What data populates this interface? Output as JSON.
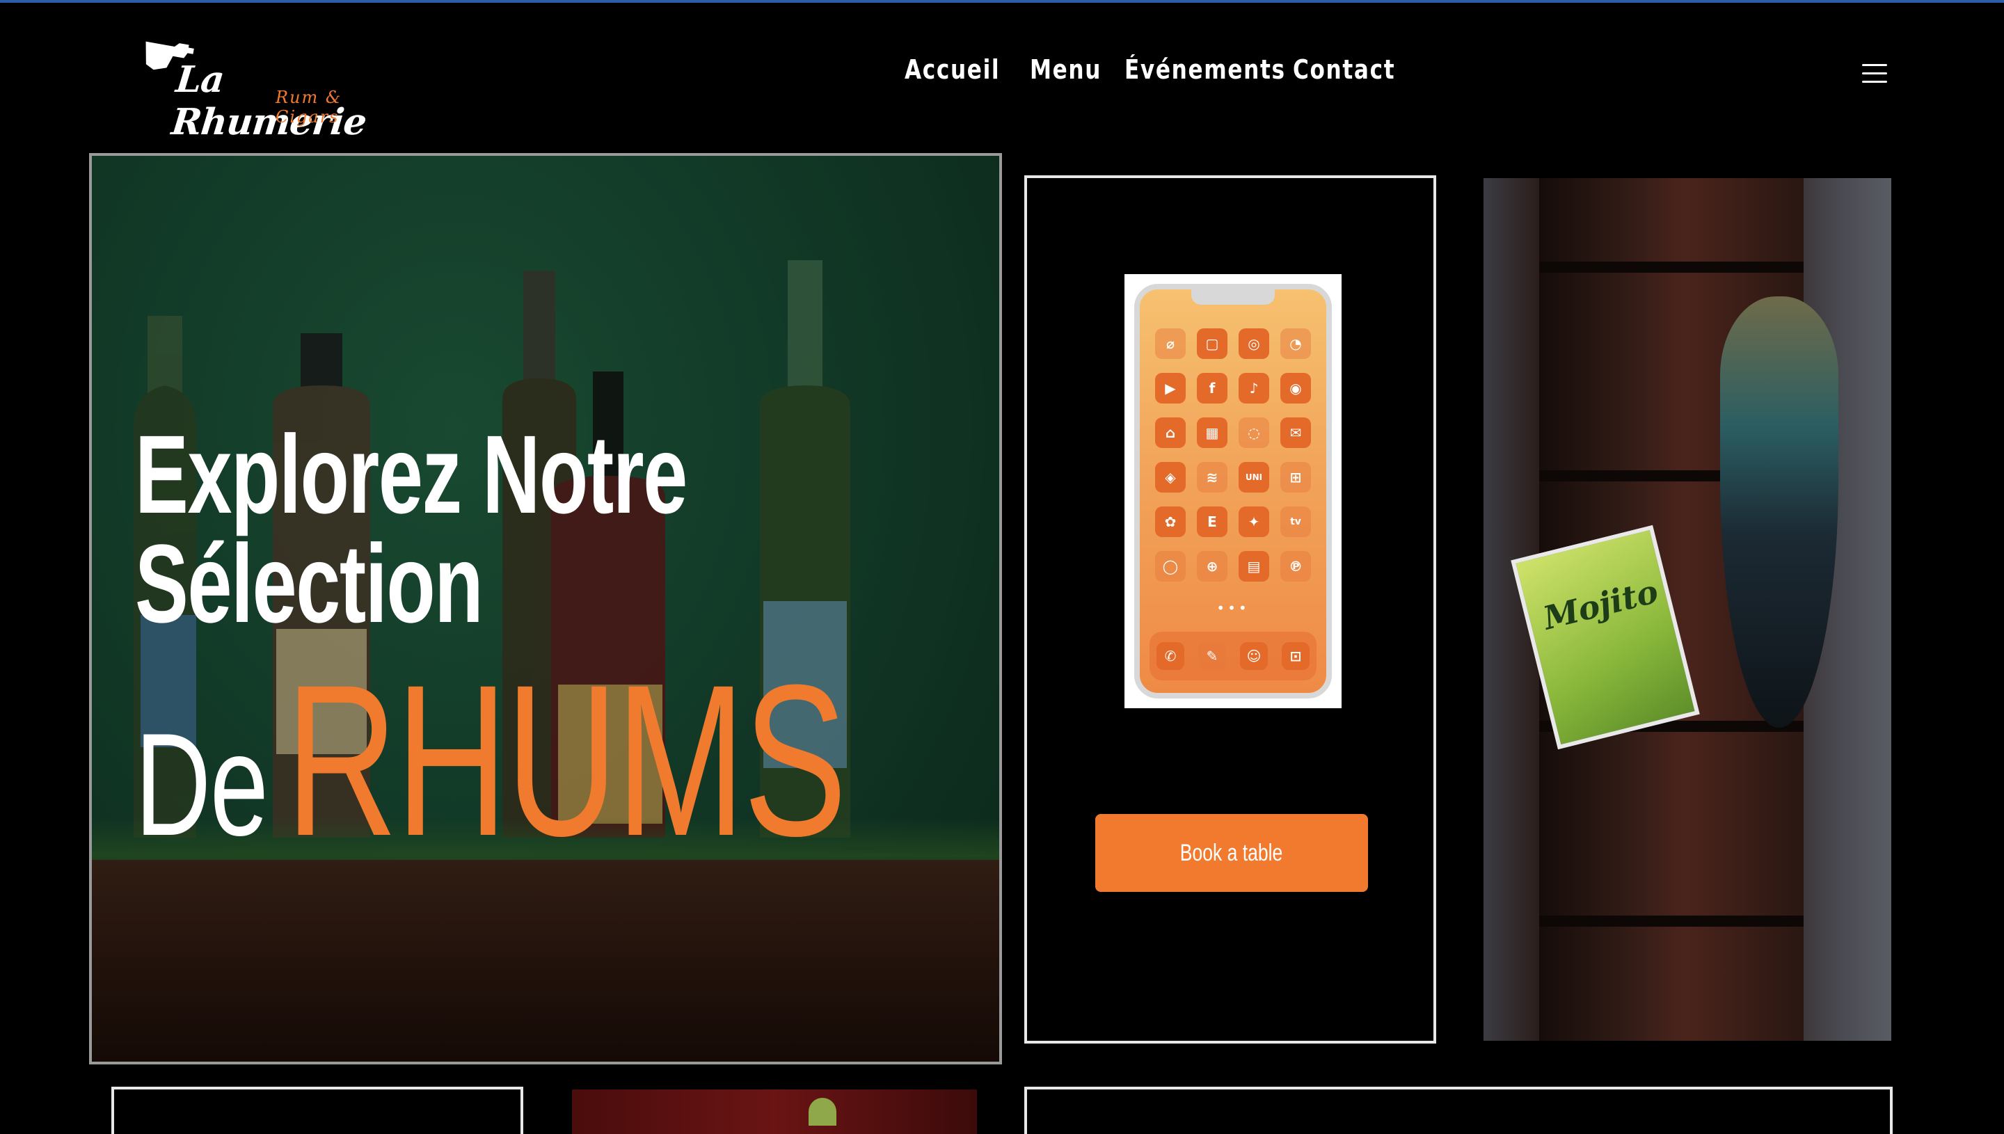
{
  "logo": {
    "title": "La Rhumerie",
    "subtitle": "Rum & Cigars"
  },
  "nav": {
    "items": [
      "Accueil",
      "Menu",
      "Événements",
      "Contact"
    ]
  },
  "hero": {
    "line1": "Explorez Notre",
    "line2": "Sélection",
    "line3_prefix": "De",
    "line3_highlight": "RHUMS"
  },
  "card": {
    "book_label": "Book a table"
  },
  "phone": {
    "apps": [
      "⌀",
      "▢",
      "◎",
      "◔",
      "▶",
      "f",
      "♪",
      "◉",
      "⌂",
      "▦",
      "◌",
      "✉",
      "◈",
      "≋",
      "UNI",
      "⊞",
      "✿",
      "E",
      "✦",
      "tv",
      "◯",
      "⊕",
      "▤",
      "℗"
    ],
    "dock": [
      "✆",
      "✎",
      "☺",
      "⊡"
    ]
  },
  "right_image": {
    "sign_text": "Mojito"
  },
  "colors": {
    "accent": "#f27a2e",
    "background": "#000000",
    "topline": "#2a5fa8"
  }
}
